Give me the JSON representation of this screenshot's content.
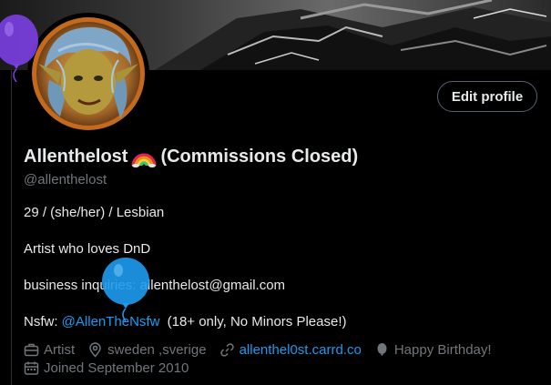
{
  "profile": {
    "display_name": "Allenthelost",
    "name_suffix": "(Commissions Closed)",
    "handle": "@allenthelost",
    "edit_button": "Edit profile"
  },
  "bio": {
    "line1": "29 / (she/her) / Lesbian",
    "line2": "Artist who loves DnD",
    "line3": "business inquiries: allenthelost@gmail.com",
    "line4_prefix": "Nsfw:",
    "line4_link": "@AllenTheNsfw",
    "line4_suffix": "(18+ only, No Minors Please!)"
  },
  "meta": {
    "category": "Artist",
    "location": "sweden ,sverige",
    "website": "allenthel0st.carrd.co",
    "birthday": "Happy Birthday!",
    "joined": "Joined September 2010"
  },
  "icons": {
    "category": "briefcase-icon",
    "location": "location-pin-icon",
    "website": "link-icon",
    "birthday": "balloon-icon",
    "joined": "calendar-icon"
  },
  "colors": {
    "background": "#000000",
    "text": "#e7e9ea",
    "muted": "#71767b",
    "link": "#1d9bf0",
    "balloon_purple": "#7b3fe4",
    "balloon_blue": "#1d9bf0"
  }
}
